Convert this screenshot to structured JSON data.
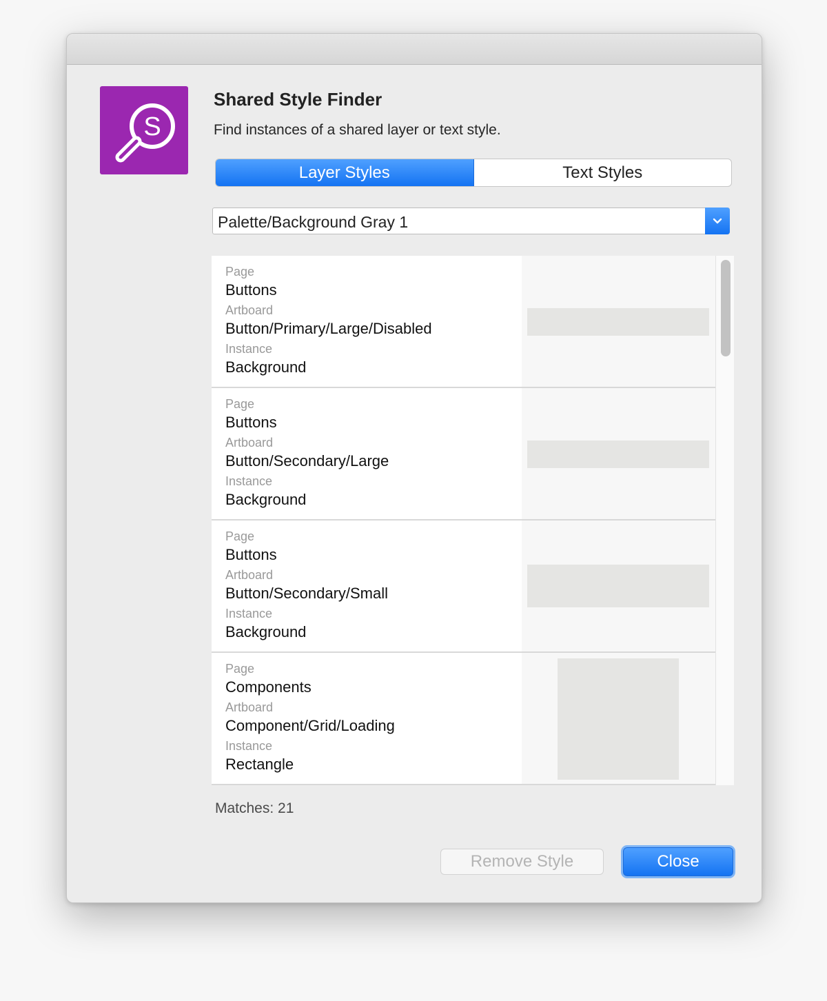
{
  "dialog": {
    "title": "Shared Style Finder",
    "subtitle": "Find instances of a shared layer or text style.",
    "icon": "magnifier-s-icon",
    "accent_color": "#9b27b0"
  },
  "tabs": [
    {
      "label": "Layer Styles",
      "active": true
    },
    {
      "label": "Text Styles",
      "active": false
    }
  ],
  "style_select": {
    "value": "Palette/Background Gray 1"
  },
  "results": [
    {
      "page_label": "Page",
      "page": "Buttons",
      "artboard_label": "Artboard",
      "artboard": "Button/Primary/Large/Disabled",
      "instance_label": "Instance",
      "instance": "Background"
    },
    {
      "page_label": "Page",
      "page": "Buttons",
      "artboard_label": "Artboard",
      "artboard": "Button/Secondary/Large",
      "instance_label": "Instance",
      "instance": "Background"
    },
    {
      "page_label": "Page",
      "page": "Buttons",
      "artboard_label": "Artboard",
      "artboard": "Button/Secondary/Small",
      "instance_label": "Instance",
      "instance": "Background"
    },
    {
      "page_label": "Page",
      "page": "Components",
      "artboard_label": "Artboard",
      "artboard": "Component/Grid/Loading",
      "instance_label": "Instance",
      "instance": "Rectangle"
    }
  ],
  "matches_text": "Matches: 21",
  "buttons": {
    "remove": "Remove Style",
    "close": "Close"
  }
}
